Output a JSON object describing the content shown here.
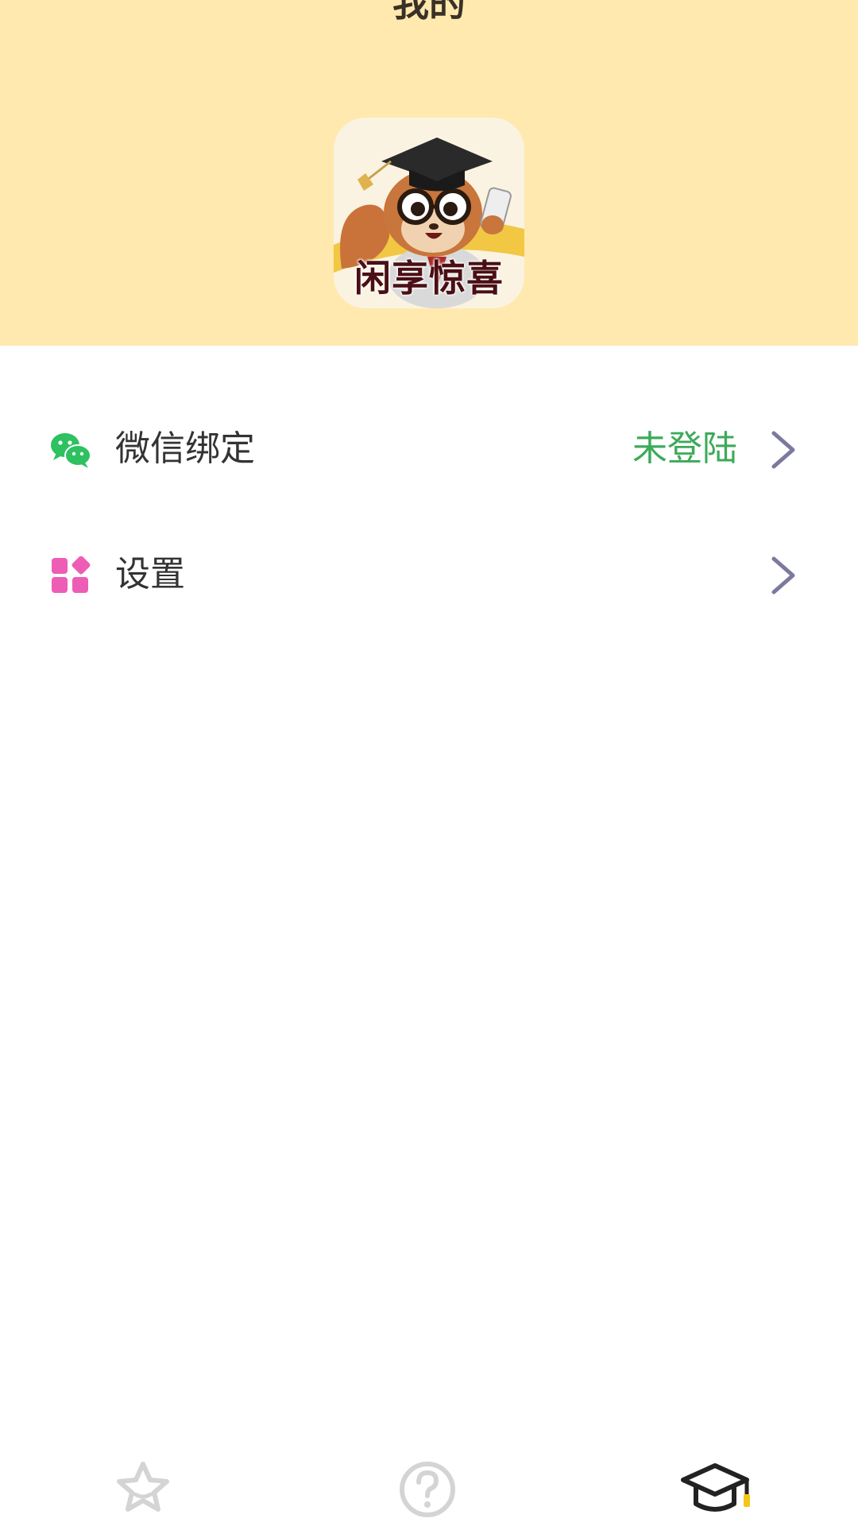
{
  "header": {
    "title": "我的",
    "background_color": "#FFE9AE"
  },
  "app_logo": {
    "text": "闲享惊喜",
    "icon": "squirrel-graduate-logo"
  },
  "menu": {
    "items": [
      {
        "icon": "wechat-icon",
        "label": "微信绑定",
        "status": "未登陆",
        "status_color": "#3DAA5A"
      },
      {
        "icon": "grid-apps-icon",
        "label": "设置",
        "status": ""
      }
    ]
  },
  "tabbar": {
    "tabs": [
      {
        "icon": "star-icon",
        "active": false
      },
      {
        "icon": "question-circle-icon",
        "active": false
      },
      {
        "icon": "graduation-cap-icon",
        "active": true
      }
    ],
    "accent_color": "#F5C518"
  }
}
